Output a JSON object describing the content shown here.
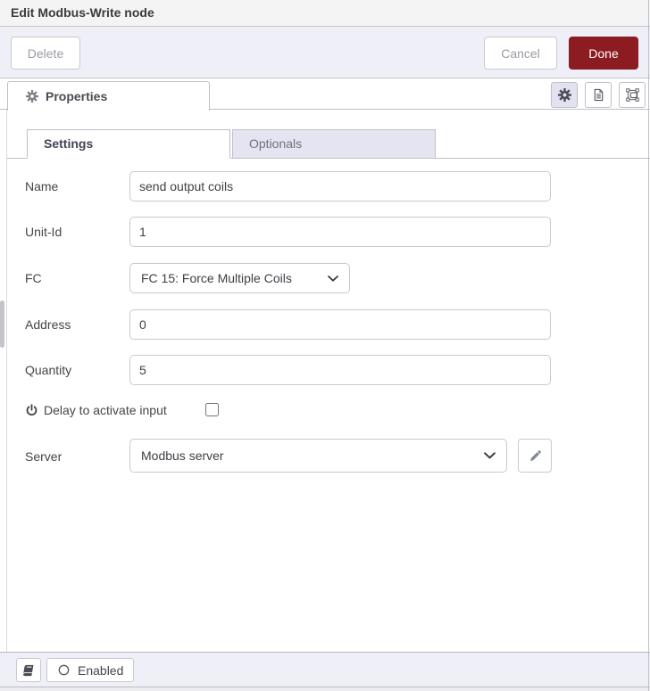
{
  "header": {
    "title": "Edit Modbus-Write node"
  },
  "toolbar": {
    "delete_label": "Delete",
    "cancel_label": "Cancel",
    "done_label": "Done"
  },
  "tray_tabs": {
    "properties_label": "Properties",
    "icon_buttons": [
      "gear-icon",
      "document-icon",
      "appearance-icon"
    ]
  },
  "tabs": {
    "settings_label": "Settings",
    "optionals_label": "Optionals"
  },
  "form": {
    "name": {
      "label": "Name",
      "value": "send output coils"
    },
    "unit_id": {
      "label": "Unit-Id",
      "value": "1"
    },
    "fc": {
      "label": "FC",
      "selected": "FC 15: Force Multiple Coils"
    },
    "address": {
      "label": "Address",
      "value": "0"
    },
    "quantity": {
      "label": "Quantity",
      "value": "5"
    },
    "delay": {
      "label": "Delay to activate input",
      "checked": false
    },
    "server": {
      "label": "Server",
      "selected": "Modbus server"
    }
  },
  "footer": {
    "enabled_label": "Enabled"
  },
  "icons": {
    "properties_tab": "gear-icon",
    "tray": [
      "gear-icon",
      "document-icon",
      "appearance-icon"
    ],
    "delay_row": "power-icon",
    "selects": "chevron-down-icon",
    "server_edit": "pencil-icon",
    "footer": [
      "book-icon",
      "circle-icon"
    ]
  },
  "colors": {
    "done_button": "#8c1c22",
    "panel_background": "#efeff8",
    "inactive_tab": "#e5e5f2",
    "border": "#c9c9cf"
  }
}
